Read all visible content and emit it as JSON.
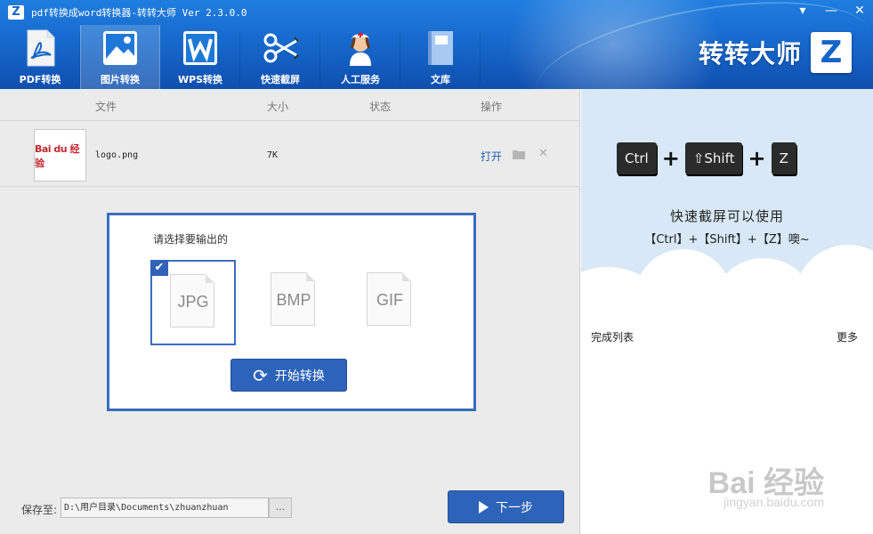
{
  "window": {
    "logo": "Z",
    "title": "pdf转换成word转换器-转转大师 Ver 2.3.0.0",
    "minimize": "▾",
    "restore": "—",
    "close": "✕"
  },
  "nav": {
    "items": [
      {
        "label": "PDF转换",
        "icon": "pdf-icon"
      },
      {
        "label": "图片转换",
        "icon": "image-icon",
        "active": true
      },
      {
        "label": "WPS转换",
        "icon": "wps-icon"
      },
      {
        "label": "快速截屏",
        "icon": "scissors-icon"
      },
      {
        "label": "人工服务",
        "icon": "nurse-icon"
      },
      {
        "label": "文库",
        "icon": "book-icon"
      }
    ]
  },
  "brand": {
    "text": "转转大师",
    "logo": "Z"
  },
  "table": {
    "headers": [
      "文件",
      "大小",
      "状态",
      "操作"
    ],
    "rows": [
      {
        "thumb_text": "Bai du 经验",
        "name": "logo.png",
        "size": "7K",
        "status": "",
        "open": "打开"
      }
    ]
  },
  "dialog": {
    "prompt": "请选择要输出的",
    "formats": [
      {
        "label": "JPG",
        "selected": true
      },
      {
        "label": "BMP",
        "selected": false
      },
      {
        "label": "GIF",
        "selected": false
      }
    ],
    "check_glyph": "✔",
    "start_label": "开始转换"
  },
  "footer": {
    "save_label": "保存至:",
    "save_path": "D:\\用户目录\\Documents\\zhuanzhuan",
    "browse_label": "...",
    "next_label": "下一步"
  },
  "sidebar": {
    "keys": [
      "Ctrl",
      "⇧Shift",
      "Z"
    ],
    "plus": "+",
    "tip_line1": "快速截屏可以使用",
    "tip_line2": "【Ctrl】+【Shift】+【Z】噢~",
    "done_title": "完成列表",
    "more": "更多"
  },
  "watermark": {
    "main": "Bai 经验",
    "sub": "jingyan.baidu.com"
  },
  "colors": {
    "header": "#1565c8",
    "accent": "#2d63b8",
    "thumb_logo": "#c0272d"
  }
}
